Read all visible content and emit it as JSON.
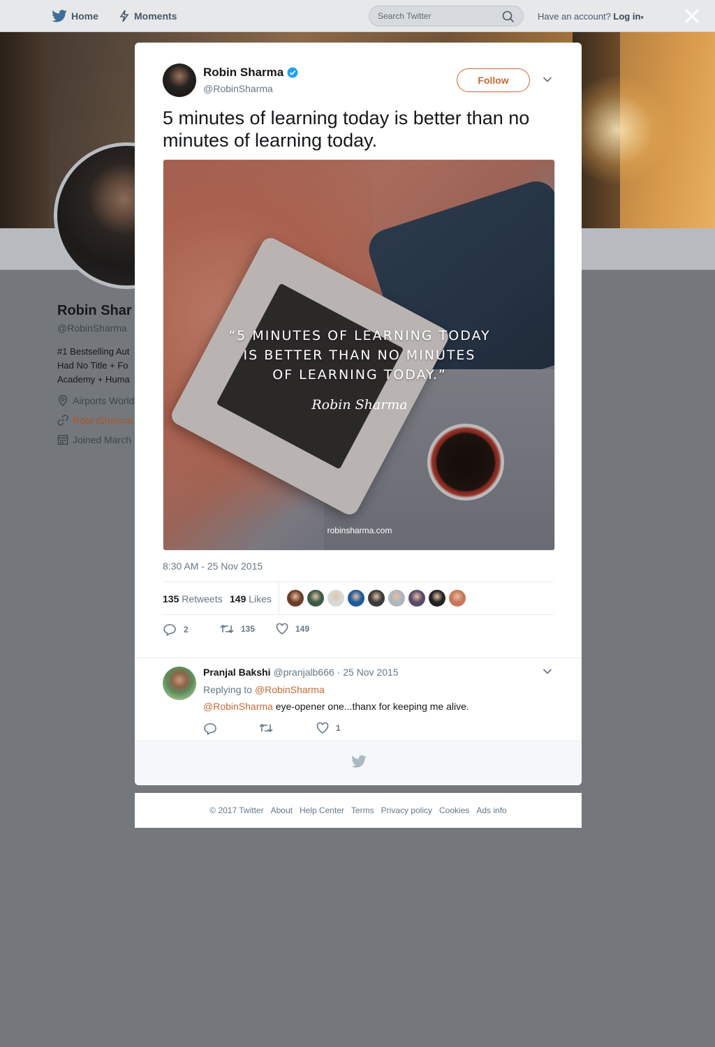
{
  "nav": {
    "home_label": "Home",
    "moments_label": "Moments",
    "search_placeholder": "Search Twitter",
    "have_account": "Have an account?",
    "login_label": "Log in"
  },
  "profile_background": {
    "name": "Robin Shar",
    "handle": "@RobinSharma",
    "bio_lines": [
      "#1 Bestselling Aut",
      "Had No Title + Fo",
      "Academy + Huma"
    ],
    "location": "Airports World",
    "website": "RobinSharma.",
    "joined": "Joined March"
  },
  "tweet": {
    "author_name": "Robin Sharma",
    "author_handle": "@RobinSharma",
    "follow_label": "Follow",
    "text": "5 minutes of learning today is better than no minutes of learning today.",
    "image_quote_lines": [
      "“5 MINUTES OF LEARNING TODAY",
      "IS BETTER THAN NO MINUTES",
      "OF LEARNING TODAY.”"
    ],
    "image_signature": "Robin Sharma",
    "image_url_text": "robinsharma.com",
    "timestamp": "8:30 AM - 25 Nov 2015",
    "retweets_count": "135",
    "retweets_label": "Retweets",
    "likes_count": "149",
    "likes_label": "Likes",
    "liker_colors": [
      "#6b3d2a",
      "#3c5a48",
      "#d8d8d8",
      "#1f5a9c",
      "#3a3a3a",
      "#aeb6be",
      "#5a4a6a",
      "#222222",
      "#c8775a"
    ],
    "reply_count": "2",
    "retweet_action_count": "135",
    "like_action_count": "149"
  },
  "reply": {
    "name": "Pranjal Bakshi",
    "handle": "@pranjalb666",
    "separator": "·",
    "date": "25 Nov 2015",
    "replying_prefix": "Replying to",
    "replying_mention": "@RobinSharma",
    "text_mention": "@RobinSharma",
    "text": "eye-opener one...thanx for keeping me alive.",
    "like_count": "1"
  },
  "footer": {
    "links": [
      "© 2017 Twitter",
      "About",
      "Help Center",
      "Terms",
      "Privacy policy",
      "Cookies",
      "Ads info"
    ]
  },
  "colors": {
    "accent": "#c66a35",
    "verified": "#1da1f2",
    "overlay": "#74787d"
  }
}
